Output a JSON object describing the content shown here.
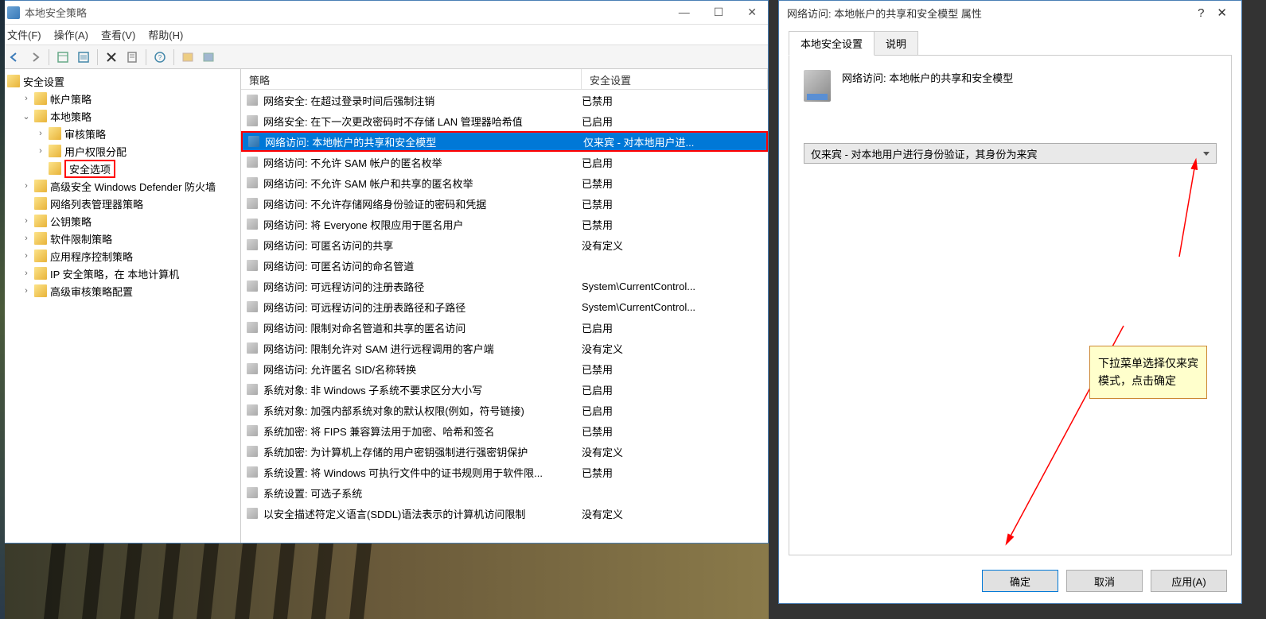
{
  "main_window": {
    "title": "本地安全策略",
    "menus": {
      "file": "文件(F)",
      "action": "操作(A)",
      "view": "查看(V)",
      "help": "帮助(H)"
    }
  },
  "tree": {
    "root": "安全设置",
    "items": [
      {
        "label": "帐户策略",
        "level": 1,
        "toggle": ">"
      },
      {
        "label": "本地策略",
        "level": 1,
        "toggle": "v"
      },
      {
        "label": "审核策略",
        "level": 2,
        "toggle": ">"
      },
      {
        "label": "用户权限分配",
        "level": 2,
        "toggle": ">"
      },
      {
        "label": "安全选项",
        "level": 2,
        "toggle": "",
        "highlighted": true
      },
      {
        "label": "高级安全 Windows Defender 防火墙",
        "level": 1,
        "toggle": ">"
      },
      {
        "label": "网络列表管理器策略",
        "level": 1,
        "toggle": ""
      },
      {
        "label": "公钥策略",
        "level": 1,
        "toggle": ">"
      },
      {
        "label": "软件限制策略",
        "level": 1,
        "toggle": ">"
      },
      {
        "label": "应用程序控制策略",
        "level": 1,
        "toggle": ">"
      },
      {
        "label": "IP 安全策略，在 本地计算机",
        "level": 1,
        "toggle": ">"
      },
      {
        "label": "高级审核策略配置",
        "level": 1,
        "toggle": ">"
      }
    ]
  },
  "list": {
    "headers": {
      "policy": "策略",
      "setting": "安全设置"
    },
    "rows": [
      {
        "policy": "网络安全: 在超过登录时间后强制注销",
        "setting": "已禁用"
      },
      {
        "policy": "网络安全: 在下一次更改密码时不存储 LAN 管理器哈希值",
        "setting": "已启用"
      },
      {
        "policy": "网络访问: 本地帐户的共享和安全模型",
        "setting": "仅来宾 - 对本地用户进...",
        "selected": true
      },
      {
        "policy": "网络访问: 不允许 SAM 帐户的匿名枚举",
        "setting": "已启用"
      },
      {
        "policy": "网络访问: 不允许 SAM 帐户和共享的匿名枚举",
        "setting": "已禁用"
      },
      {
        "policy": "网络访问: 不允许存储网络身份验证的密码和凭据",
        "setting": "已禁用"
      },
      {
        "policy": "网络访问: 将 Everyone 权限应用于匿名用户",
        "setting": "已禁用"
      },
      {
        "policy": "网络访问: 可匿名访问的共享",
        "setting": "没有定义"
      },
      {
        "policy": "网络访问: 可匿名访问的命名管道",
        "setting": ""
      },
      {
        "policy": "网络访问: 可远程访问的注册表路径",
        "setting": "System\\CurrentControl..."
      },
      {
        "policy": "网络访问: 可远程访问的注册表路径和子路径",
        "setting": "System\\CurrentControl..."
      },
      {
        "policy": "网络访问: 限制对命名管道和共享的匿名访问",
        "setting": "已启用"
      },
      {
        "policy": "网络访问: 限制允许对 SAM 进行远程调用的客户端",
        "setting": "没有定义"
      },
      {
        "policy": "网络访问: 允许匿名 SID/名称转换",
        "setting": "已禁用"
      },
      {
        "policy": "系统对象: 非 Windows 子系统不要求区分大小写",
        "setting": "已启用"
      },
      {
        "policy": "系统对象: 加强内部系统对象的默认权限(例如，符号链接)",
        "setting": "已启用"
      },
      {
        "policy": "系统加密: 将 FIPS 兼容算法用于加密、哈希和签名",
        "setting": "已禁用"
      },
      {
        "policy": "系统加密: 为计算机上存储的用户密钥强制进行强密钥保护",
        "setting": "没有定义"
      },
      {
        "policy": "系统设置: 将 Windows 可执行文件中的证书规则用于软件限...",
        "setting": "已禁用"
      },
      {
        "policy": "系统设置: 可选子系统",
        "setting": ""
      },
      {
        "policy": "以安全描述符定义语言(SDDL)语法表示的计算机访问限制",
        "setting": "没有定义"
      }
    ]
  },
  "props": {
    "title": "网络访问: 本地帐户的共享和安全模型 属性",
    "tabs": {
      "local": "本地安全设置",
      "explain": "说明"
    },
    "policy_name": "网络访问: 本地帐户的共享和安全模型",
    "dropdown_value": "仅来宾 - 对本地用户进行身份验证，其身份为来宾",
    "annotation": "下拉菜单选择仅来宾模式，点击确定",
    "buttons": {
      "ok": "确定",
      "cancel": "取消",
      "apply": "应用(A)"
    }
  }
}
